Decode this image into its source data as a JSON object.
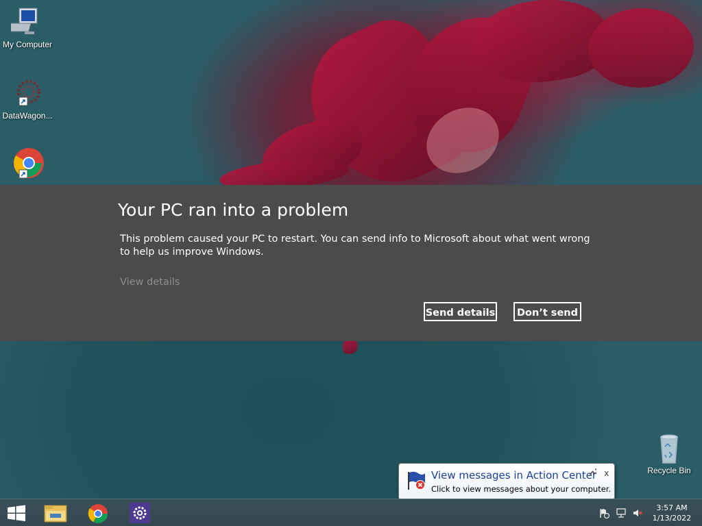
{
  "desktop": {
    "icons": [
      {
        "label": "My Computer",
        "icon": "computer-icon"
      },
      {
        "label": "DataWagon...",
        "icon": "datawagon-icon"
      },
      {
        "label": "",
        "icon": "chrome-shortcut-icon"
      },
      {
        "label": "Recycle Bin",
        "icon": "recycle-bin-icon"
      }
    ]
  },
  "dialog": {
    "title": "Your PC ran into a problem",
    "message": "This problem caused your PC to restart. You can send info to Microsoft about what went wrong to help us improve Windows.",
    "view_details": "View details",
    "send_label": "Send details",
    "dont_send_label": "Don’t send"
  },
  "notification": {
    "title": "View messages in Action Center",
    "body": "Click to view messages about your computer.",
    "close_label": "x",
    "icon": "action-center-flag-icon"
  },
  "taskbar": {
    "items": [
      {
        "name": "start-button",
        "icon": "windows-logo-icon"
      },
      {
        "name": "file-explorer-button",
        "icon": "folder-icon"
      },
      {
        "name": "chrome-button",
        "icon": "chrome-icon"
      },
      {
        "name": "settings-button",
        "icon": "gear-icon"
      }
    ],
    "tray": {
      "icons": [
        "action-center-icon",
        "network-icon",
        "volume-muted-icon"
      ],
      "time": "3:57 AM",
      "date": "1/13/2022"
    }
  },
  "colors": {
    "dialog_band": "#4b4b4b",
    "taskbar": "#34474f",
    "notification_title": "#1b3f9a",
    "view_details": "#8f8f8f"
  }
}
